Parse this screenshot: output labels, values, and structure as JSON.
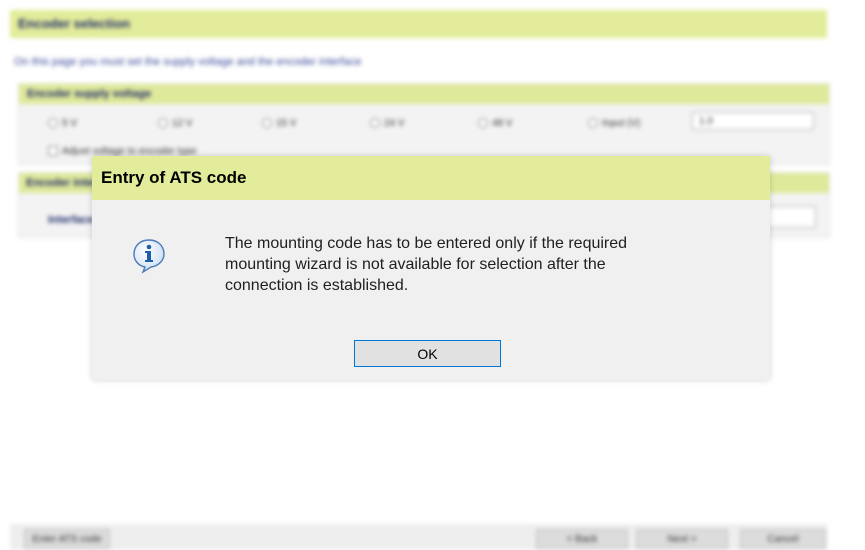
{
  "background": {
    "header_title": "Encoder selection",
    "hint": "On this page you must set the supply voltage and the encoder interface",
    "supply_group_title": "Encoder supply voltage",
    "supply_options": [
      "5 V",
      "12 V",
      "15 V",
      "24 V",
      "48 V",
      "Input (V)"
    ],
    "supply_value": "1.0",
    "supply_check_label": "Adjust voltage to encoder type",
    "interface_group_title": "Encoder interface",
    "interface_label": "Interface",
    "footer_buttons": {
      "enter_code": "Enter ATS code",
      "back": "< Back",
      "next": "Next >",
      "cancel": "Cancel"
    }
  },
  "dialog": {
    "title": "Entry of ATS code",
    "icon": "info-icon",
    "message_lines": [
      "The mounting code has to be entered only if the required",
      "mounting wizard is not available for selection after the",
      "connection is established."
    ],
    "ok_label": "OK"
  },
  "colors": {
    "title_bar": "#e3ec9a",
    "focus_border": "#0078d7",
    "info_icon": "#2a6fb4"
  }
}
